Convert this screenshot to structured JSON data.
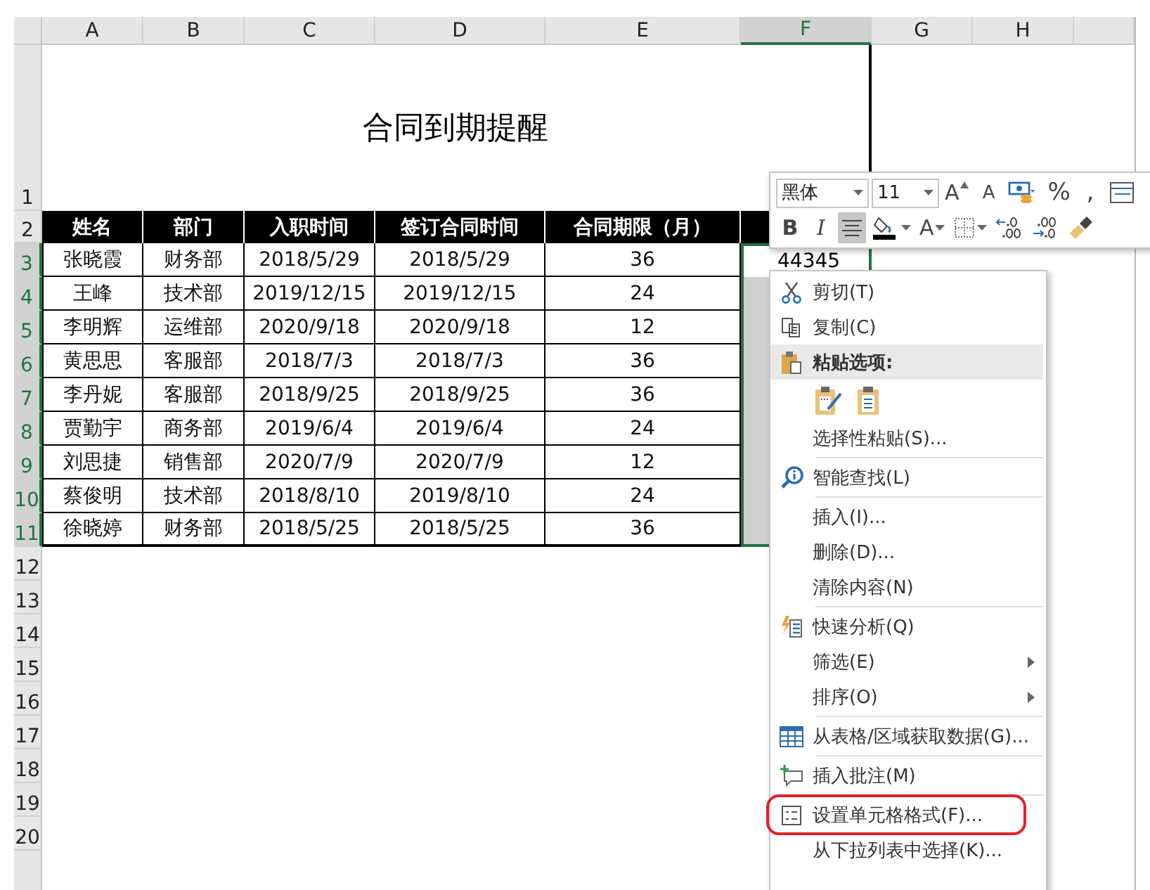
{
  "column_headers": [
    {
      "label": "A",
      "selected": false
    },
    {
      "label": "B",
      "selected": false
    },
    {
      "label": "C",
      "selected": false
    },
    {
      "label": "D",
      "selected": false
    },
    {
      "label": "E",
      "selected": false
    },
    {
      "label": "F",
      "selected": true
    },
    {
      "label": "G",
      "selected": false
    },
    {
      "label": "H",
      "selected": false
    }
  ],
  "row_headers": [
    {
      "label": "1",
      "selected": false
    },
    {
      "label": "2",
      "selected": false
    },
    {
      "label": "3",
      "selected": true
    },
    {
      "label": "4",
      "selected": true
    },
    {
      "label": "5",
      "selected": true
    },
    {
      "label": "6",
      "selected": true
    },
    {
      "label": "7",
      "selected": true
    },
    {
      "label": "8",
      "selected": true
    },
    {
      "label": "9",
      "selected": true
    },
    {
      "label": "10",
      "selected": true
    },
    {
      "label": "11",
      "selected": true
    },
    {
      "label": "12",
      "selected": false
    },
    {
      "label": "13",
      "selected": false
    },
    {
      "label": "14",
      "selected": false
    },
    {
      "label": "15",
      "selected": false
    },
    {
      "label": "16",
      "selected": false
    },
    {
      "label": "17",
      "selected": false
    },
    {
      "label": "18",
      "selected": false
    },
    {
      "label": "19",
      "selected": false
    },
    {
      "label": "20",
      "selected": false
    }
  ],
  "title": "合同到期提醒",
  "table": {
    "columns": [
      "姓名",
      "部门",
      "入职时间",
      "签订合同时间",
      "合同期限（月）"
    ],
    "rows": [
      [
        "张晓霞",
        "财务部",
        "2018/5/29",
        "2018/5/29",
        "36"
      ],
      [
        "王峰",
        "技术部",
        "2019/12/15",
        "2019/12/15",
        "24"
      ],
      [
        "李明辉",
        "运维部",
        "2020/9/18",
        "2020/9/18",
        "12"
      ],
      [
        "黄思思",
        "客服部",
        "2018/7/3",
        "2018/7/3",
        "36"
      ],
      [
        "李丹妮",
        "客服部",
        "2018/9/25",
        "2018/9/25",
        "36"
      ],
      [
        "贾勤宇",
        "商务部",
        "2019/6/4",
        "2019/6/4",
        "24"
      ],
      [
        "刘思捷",
        "销售部",
        "2020/7/9",
        "2020/7/9",
        "12"
      ],
      [
        "蔡俊明",
        "技术部",
        "2018/8/10",
        "2019/8/10",
        "24"
      ],
      [
        "徐晓婷",
        "财务部",
        "2018/5/25",
        "2018/5/25",
        "36"
      ]
    ]
  },
  "active_cell": {
    "value": "44345"
  },
  "mini_toolbar": {
    "rows": [
      [
        {
          "kind": "font",
          "value": "黑体"
        },
        {
          "kind": "size",
          "value": "11"
        },
        {
          "kind": "grow-font",
          "label": "A"
        },
        {
          "kind": "shrink-font",
          "label": "A"
        },
        {
          "kind": "number-format"
        },
        {
          "kind": "percent",
          "label": "%"
        },
        {
          "kind": "comma",
          "label": ","
        },
        {
          "kind": "table-style"
        }
      ],
      [
        {
          "kind": "bold",
          "label": "B",
          "on": false
        },
        {
          "kind": "italic",
          "label": "I",
          "on": false
        },
        {
          "kind": "align-center",
          "on": true
        },
        {
          "kind": "fill-color"
        },
        {
          "kind": "font-color",
          "label": "A"
        },
        {
          "kind": "borders"
        },
        {
          "kind": "increase-decimal"
        },
        {
          "kind": "decrease-decimal"
        },
        {
          "kind": "format-painter"
        }
      ]
    ]
  },
  "context_menu": {
    "items": [
      {
        "kind": "cut",
        "label": "剪切(T)",
        "circled": false
      },
      {
        "kind": "copy",
        "label": "复制(C)",
        "circled": false
      },
      {
        "kind": "paste-heading",
        "label": "粘贴选项:",
        "circled": false
      },
      {
        "kind": "paste-buttons",
        "circled": false
      },
      {
        "kind": "command",
        "label": "选择性粘贴(S)...",
        "circled": false
      },
      {
        "kind": "separator"
      },
      {
        "kind": "lookup",
        "label": "智能查找(L)",
        "circled": false
      },
      {
        "kind": "separator"
      },
      {
        "kind": "command",
        "label": "插入(I)...",
        "circled": false
      },
      {
        "kind": "command",
        "label": "删除(D)...",
        "circled": false
      },
      {
        "kind": "command",
        "label": "清除内容(N)",
        "circled": false
      },
      {
        "kind": "separator"
      },
      {
        "kind": "quick-analysis",
        "label": "快速分析(Q)",
        "circled": false
      },
      {
        "kind": "submenu",
        "label": "筛选(E)",
        "circled": false
      },
      {
        "kind": "submenu",
        "label": "排序(O)",
        "circled": false
      },
      {
        "kind": "separator"
      },
      {
        "kind": "get-data",
        "label": "从表格/区域获取数据(G)...",
        "circled": false
      },
      {
        "kind": "separator"
      },
      {
        "kind": "comment",
        "label": "插入批注(M)",
        "circled": false
      },
      {
        "kind": "separator"
      },
      {
        "kind": "format-cells",
        "label": "设置单元格格式(F)...",
        "circled": true
      },
      {
        "kind": "command",
        "label": "从下拉列表中选择(K)...",
        "circled": false
      }
    ]
  }
}
